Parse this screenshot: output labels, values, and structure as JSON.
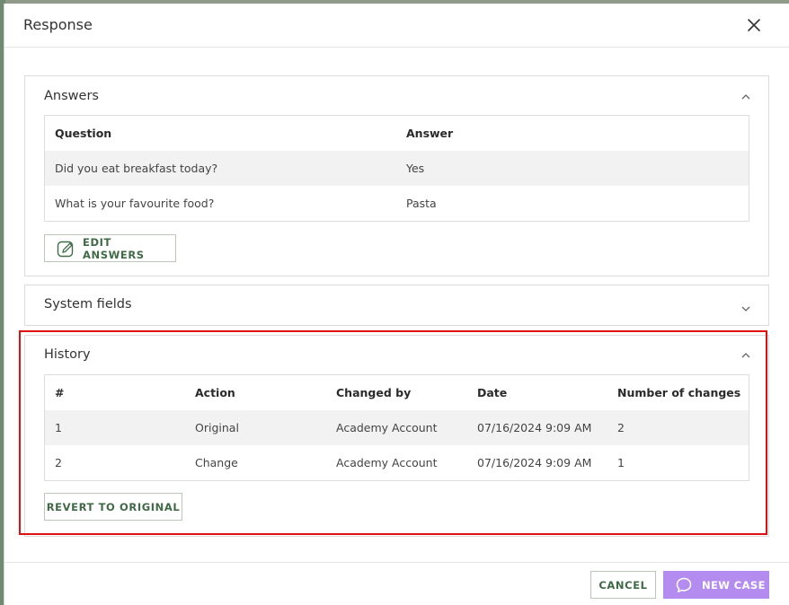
{
  "dialog": {
    "title": "Response",
    "close_icon": "close-icon"
  },
  "answers": {
    "title": "Answers",
    "toggle_icon": "chevron-up-icon",
    "columns": [
      "Question",
      "Answer"
    ],
    "rows": [
      [
        "Did you eat breakfast today?",
        "Yes"
      ],
      [
        "What is your favourite food?",
        "Pasta"
      ]
    ],
    "edit_button": "EDIT ANSWERS",
    "edit_icon": "edit-icon"
  },
  "system_fields": {
    "title": "System fields",
    "toggle_icon": "chevron-down-icon"
  },
  "history": {
    "title": "History",
    "toggle_icon": "chevron-up-icon",
    "columns": [
      "#",
      "Action",
      "Changed by",
      "Date",
      "Number of changes"
    ],
    "rows": [
      [
        "1",
        "Original",
        "Academy Account",
        "07/16/2024 9:09 AM",
        "2"
      ],
      [
        "2",
        "Change",
        "Academy Account",
        "07/16/2024 9:09 AM",
        "1"
      ]
    ],
    "revert_button": "REVERT TO ORIGINAL"
  },
  "footer": {
    "cancel_button": "CANCEL",
    "new_case_button": "NEW CASE",
    "new_case_icon": "chat-bubble-icon"
  },
  "colors": {
    "accent_green": "#3f6a45",
    "new_case_purple": "#b48cf0",
    "highlight_red": "#e01010"
  }
}
